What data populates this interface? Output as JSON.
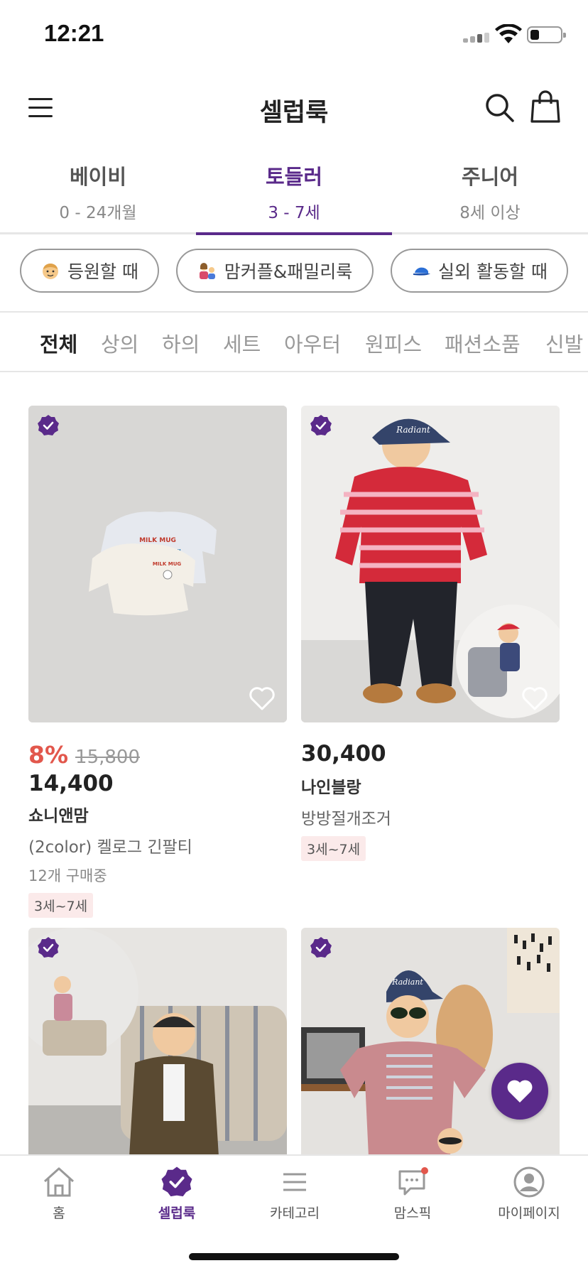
{
  "status_bar": {
    "time": "12:21"
  },
  "header": {
    "title": "셀럽룩",
    "menu_icon": "hamburger-menu-icon",
    "search_icon": "search-icon",
    "cart_icon": "shopping-bag-icon"
  },
  "age_tabs": [
    {
      "label": "베이비",
      "range": "0 - 24개월",
      "active": false
    },
    {
      "label": "토들러",
      "range": "3 - 7세",
      "active": true
    },
    {
      "label": "주니어",
      "range": "8세 이상",
      "active": false
    }
  ],
  "chips": [
    {
      "icon": "child-face-emoji",
      "label": "등원할 때"
    },
    {
      "icon": "mother-child-emoji",
      "label": "맘커플&패밀리룩"
    },
    {
      "icon": "blue-cap-emoji",
      "label": "실외 활동할 때"
    }
  ],
  "categories": [
    {
      "label": "전체",
      "active": true
    },
    {
      "label": "상의",
      "active": false
    },
    {
      "label": "하의",
      "active": false
    },
    {
      "label": "세트",
      "active": false
    },
    {
      "label": "아우터",
      "active": false
    },
    {
      "label": "원피스",
      "active": false
    },
    {
      "label": "패션소품",
      "active": false
    },
    {
      "label": "신발",
      "active": false
    }
  ],
  "products": [
    {
      "discount": "8%",
      "original_price": "15,800",
      "price": "14,400",
      "brand": "쇼니앤맘",
      "name": "(2color) 켈로그 긴팔티",
      "buying": "12개 구매중",
      "age": "3세~7세",
      "image": "milk-mug-sweatshirts-photo"
    },
    {
      "price": "30,400",
      "brand": "나인블랑",
      "name": "방방절개조거",
      "age": "3세~7세",
      "image": "red-striped-polo-kid-photo"
    },
    {
      "image": "kid-brown-jacket-photo"
    },
    {
      "image": "kid-pink-jacket-sunglasses-photo"
    }
  ],
  "fab": {
    "icon": "heart-icon"
  },
  "bottom_nav": [
    {
      "label": "홈",
      "icon": "home-icon",
      "active": false
    },
    {
      "label": "셀럽룩",
      "icon": "verified-badge-icon",
      "active": true
    },
    {
      "label": "카테고리",
      "icon": "list-icon",
      "active": false
    },
    {
      "label": "맘스픽",
      "icon": "chat-bubble-icon",
      "active": false
    },
    {
      "label": "마이페이지",
      "icon": "profile-icon",
      "active": false
    }
  ],
  "colors": {
    "accent": "#5a2a8a",
    "discount": "#e2574c",
    "badge_bg": "#fbeaea"
  }
}
